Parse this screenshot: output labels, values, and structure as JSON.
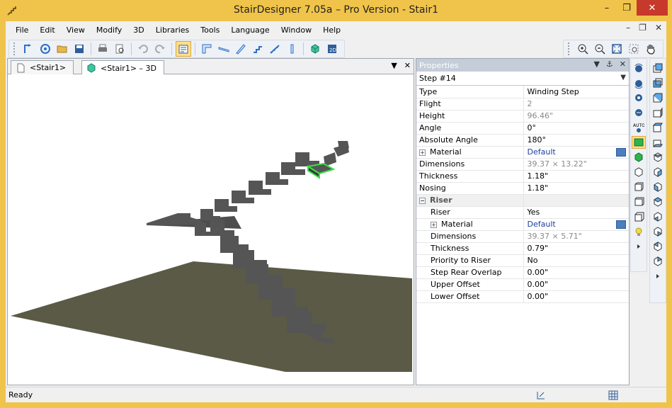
{
  "window": {
    "title": "StairDesigner 7.05a – Pro Version - Stair1",
    "minimize": "–",
    "restore": "❐",
    "close": "✕"
  },
  "menu": [
    "File",
    "Edit",
    "View",
    "Modify",
    "3D",
    "Libraries",
    "Tools",
    "Language",
    "Window",
    "Help"
  ],
  "mdi": {
    "minimize": "–",
    "restore": "❐",
    "close": "✕"
  },
  "tabs": [
    {
      "label": "<Stair1>",
      "icon": "document-icon",
      "active": false
    },
    {
      "label": "<Stair1> – 3D",
      "icon": "cube-3d-icon",
      "active": true
    }
  ],
  "tab_controls": {
    "dropdown": "▼",
    "close": "✕"
  },
  "properties": {
    "title": "Properties",
    "header_buttons": {
      "dropdown": "▼",
      "pin": "⚓",
      "close": "✕"
    },
    "selector": "Step #14",
    "rows": [
      {
        "key": "Type",
        "value": "Winding Step",
        "style": "normal"
      },
      {
        "key": "Flight",
        "value": "2",
        "style": "gray"
      },
      {
        "key": "Height",
        "value": "96.46\"",
        "style": "gray"
      },
      {
        "key": "Angle",
        "value": "0°",
        "style": "normal"
      },
      {
        "key": "Absolute Angle",
        "value": "180°",
        "style": "normal"
      },
      {
        "key": "Material",
        "value": "Default",
        "style": "link",
        "expandable": true,
        "button": true
      },
      {
        "key": "Dimensions",
        "value": "39.37 × 13.22\"",
        "style": "gray"
      },
      {
        "key": "Thickness",
        "value": "1.18\"",
        "style": "normal"
      },
      {
        "key": "Nosing",
        "value": "1.18\"",
        "style": "normal"
      }
    ],
    "riser_group": {
      "label": "Riser",
      "rows": [
        {
          "key": "Riser",
          "value": "Yes",
          "style": "normal"
        },
        {
          "key": "Material",
          "value": "Default",
          "style": "link",
          "expandable": true,
          "button": true
        },
        {
          "key": "Dimensions",
          "value": "39.37 × 5.71\"",
          "style": "gray"
        },
        {
          "key": "Thickness",
          "value": "0.79\"",
          "style": "normal"
        },
        {
          "key": "Priority to Riser",
          "value": "No",
          "style": "normal"
        },
        {
          "key": "Step Rear Overlap",
          "value": "0.00\"",
          "style": "normal"
        },
        {
          "key": "Upper Offset",
          "value": "0.00\"",
          "style": "normal"
        },
        {
          "key": "Lower Offset",
          "value": "0.00\"",
          "style": "normal"
        }
      ]
    }
  },
  "status": {
    "text": "Ready"
  },
  "colors": {
    "titlebar": "#f0c44a",
    "close_button": "#c7392b",
    "floor": "#5b5a46",
    "stair": "#555555",
    "selection": "#39e04a",
    "link_text": "#1d3fa0"
  }
}
